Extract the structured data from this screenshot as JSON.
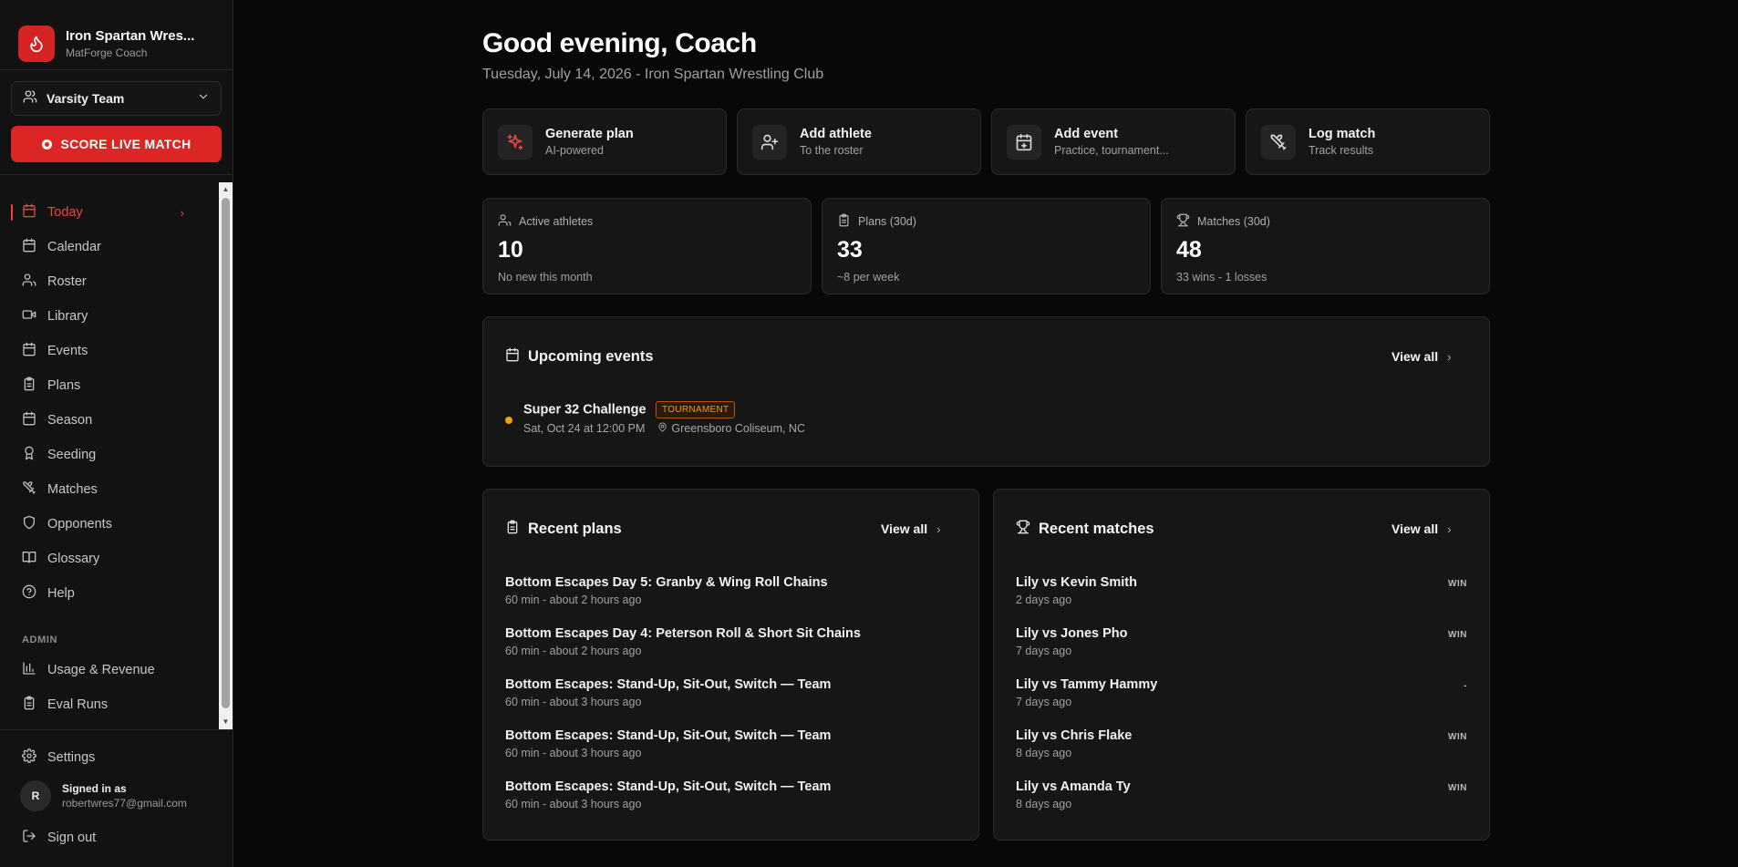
{
  "app": {
    "club_name": "Iron Spartan Wres...",
    "product": "MatForge Coach",
    "team_selector": "Varsity Team",
    "live_button": "SCORE LIVE MATCH"
  },
  "nav": {
    "items": [
      {
        "label": "Today",
        "icon": "calendar-icon",
        "active": true
      },
      {
        "label": "Calendar",
        "icon": "calendar-icon"
      },
      {
        "label": "Roster",
        "icon": "users-icon"
      },
      {
        "label": "Library",
        "icon": "video-icon"
      },
      {
        "label": "Events",
        "icon": "calendar-icon"
      },
      {
        "label": "Plans",
        "icon": "clipboard-icon"
      },
      {
        "label": "Season",
        "icon": "calendar-icon"
      },
      {
        "label": "Seeding",
        "icon": "award-icon"
      },
      {
        "label": "Matches",
        "icon": "swords-icon"
      },
      {
        "label": "Opponents",
        "icon": "shield-icon"
      },
      {
        "label": "Glossary",
        "icon": "book-icon"
      },
      {
        "label": "Help",
        "icon": "help-icon"
      }
    ],
    "admin_heading": "ADMIN",
    "admin_items": [
      {
        "label": "Usage & Revenue",
        "icon": "bar-chart-icon"
      },
      {
        "label": "Eval Runs",
        "icon": "clipboard-icon"
      }
    ]
  },
  "footer": {
    "settings": "Settings",
    "signed_in_label": "Signed in as",
    "email": "robertwres77@gmail.com",
    "avatar_initial": "R",
    "sign_out": "Sign out"
  },
  "header": {
    "greeting": "Good evening, Coach",
    "subline": "Tuesday, July 14, 2026 - Iron Spartan Wrestling Club"
  },
  "quick_actions": [
    {
      "title": "Generate plan",
      "subtitle": "AI-powered",
      "icon": "sparkles-icon"
    },
    {
      "title": "Add athlete",
      "subtitle": "To the roster",
      "icon": "user-plus-icon"
    },
    {
      "title": "Add event",
      "subtitle": "Practice, tournament...",
      "icon": "calendar-plus-icon"
    },
    {
      "title": "Log match",
      "subtitle": "Track results",
      "icon": "swords-icon"
    }
  ],
  "stats": [
    {
      "label": "Active athletes",
      "value": "10",
      "note": "No new this month",
      "icon": "users-icon"
    },
    {
      "label": "Plans (30d)",
      "value": "33",
      "note": "~8 per week",
      "icon": "clipboard-icon"
    },
    {
      "label": "Matches (30d)",
      "value": "48",
      "note": "33 wins - 1 losses",
      "icon": "trophy-icon"
    }
  ],
  "upcoming": {
    "title": "Upcoming events",
    "view_all": "View all",
    "events": [
      {
        "name": "Super 32 Challenge",
        "badge": "TOURNAMENT",
        "date": "Sat, Oct 24 at 12:00 PM",
        "location": "Greensboro Coliseum, NC"
      }
    ]
  },
  "recent_plans": {
    "title": "Recent plans",
    "view_all": "View all",
    "items": [
      {
        "title": "Bottom Escapes Day 5: Granby & Wing Roll Chains",
        "meta": "60 min - about 2 hours ago"
      },
      {
        "title": "Bottom Escapes Day 4: Peterson Roll & Short Sit Chains",
        "meta": "60 min - about 2 hours ago"
      },
      {
        "title": "Bottom Escapes: Stand-Up, Sit-Out, Switch — Team",
        "meta": "60 min - about 3 hours ago"
      },
      {
        "title": "Bottom Escapes: Stand-Up, Sit-Out, Switch — Team",
        "meta": "60 min - about 3 hours ago"
      },
      {
        "title": "Bottom Escapes: Stand-Up, Sit-Out, Switch — Team",
        "meta": "60 min - about 3 hours ago"
      }
    ]
  },
  "recent_matches": {
    "title": "Recent matches",
    "view_all": "View all",
    "items": [
      {
        "title": "Lily vs Kevin Smith",
        "meta": "2 days ago",
        "result": "WIN"
      },
      {
        "title": "Lily vs Jones Pho",
        "meta": "7 days ago",
        "result": "WIN"
      },
      {
        "title": "Lily vs Tammy Hammy",
        "meta": "7 days ago",
        "result": "-"
      },
      {
        "title": "Lily vs Chris Flake",
        "meta": "8 days ago",
        "result": "WIN"
      },
      {
        "title": "Lily vs Amanda Ty",
        "meta": "8 days ago",
        "result": "WIN"
      }
    ]
  },
  "colors": {
    "accent": "#dc2626",
    "event_dot": "#f59e0b",
    "background": "#080808",
    "card": "#161616"
  }
}
